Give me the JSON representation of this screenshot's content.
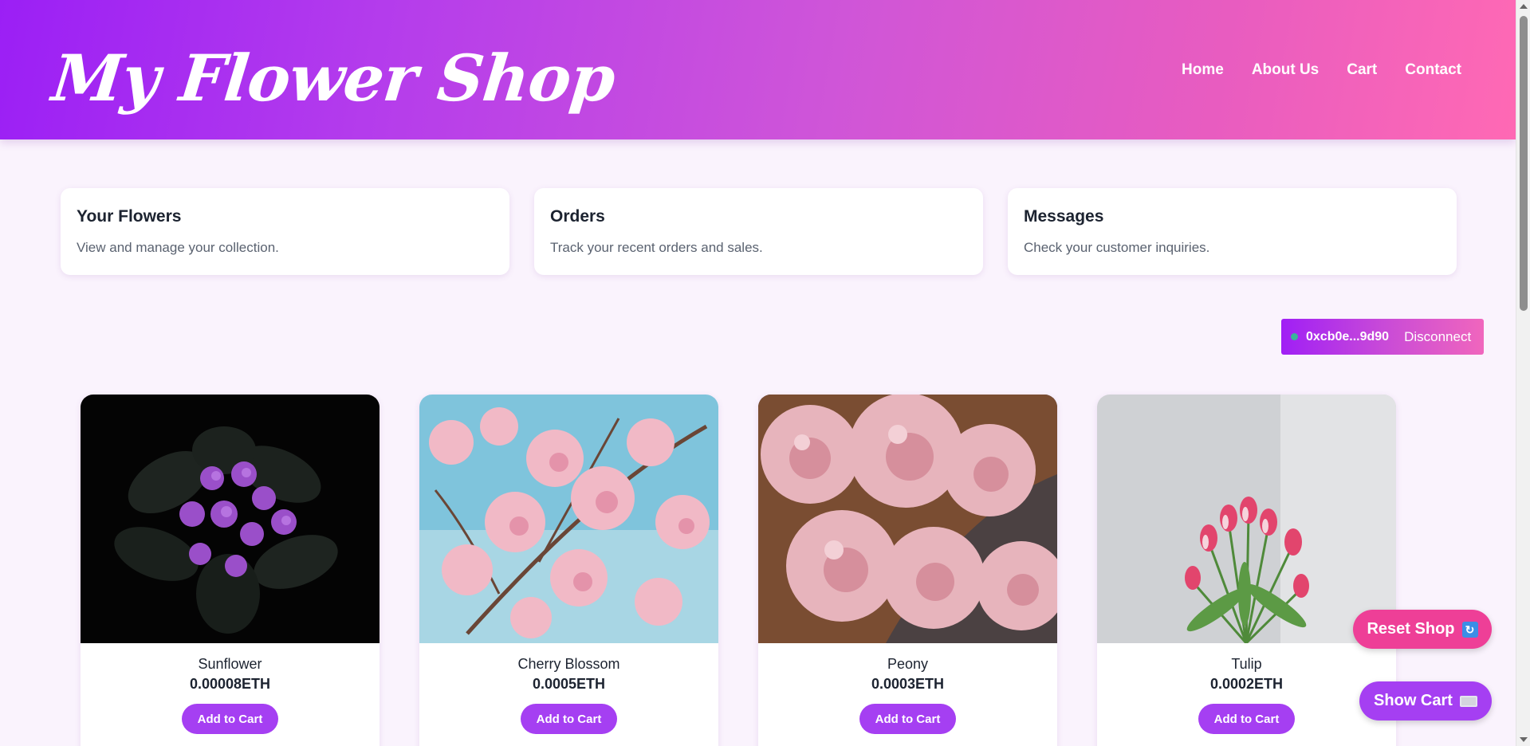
{
  "header": {
    "logo": "My Flower Shop",
    "nav": [
      "Home",
      "About Us",
      "Cart",
      "Contact"
    ]
  },
  "cards": [
    {
      "title": "Your Flowers",
      "description": "View and manage your collection."
    },
    {
      "title": "Orders",
      "description": "Track your recent orders and sales."
    },
    {
      "title": "Messages",
      "description": "Check your customer inquiries."
    }
  ],
  "wallet": {
    "address": "0xcb0e...9d90",
    "disconnect_label": "Disconnect",
    "status_color": "#3ab39b"
  },
  "products": [
    {
      "name": "Sunflower",
      "price": "0.00008ETH",
      "button": "Add to Cart"
    },
    {
      "name": "Cherry Blossom",
      "price": "0.0005ETH",
      "button": "Add to Cart"
    },
    {
      "name": "Peony",
      "price": "0.0003ETH",
      "button": "Add to Cart"
    },
    {
      "name": "Tulip",
      "price": "0.0002ETH",
      "button": "Add to Cart"
    }
  ],
  "floating": {
    "reset_label": "Reset Shop",
    "reset_icon": "refresh-icon",
    "cart_label": "Show Cart",
    "cart_icon": "keyboard-icon"
  },
  "colors": {
    "header_start": "#9b1ff5",
    "header_end": "#ff69b4",
    "accent": "#a53ff2",
    "reset": "#ee3f97",
    "background": "#faf3fd"
  }
}
